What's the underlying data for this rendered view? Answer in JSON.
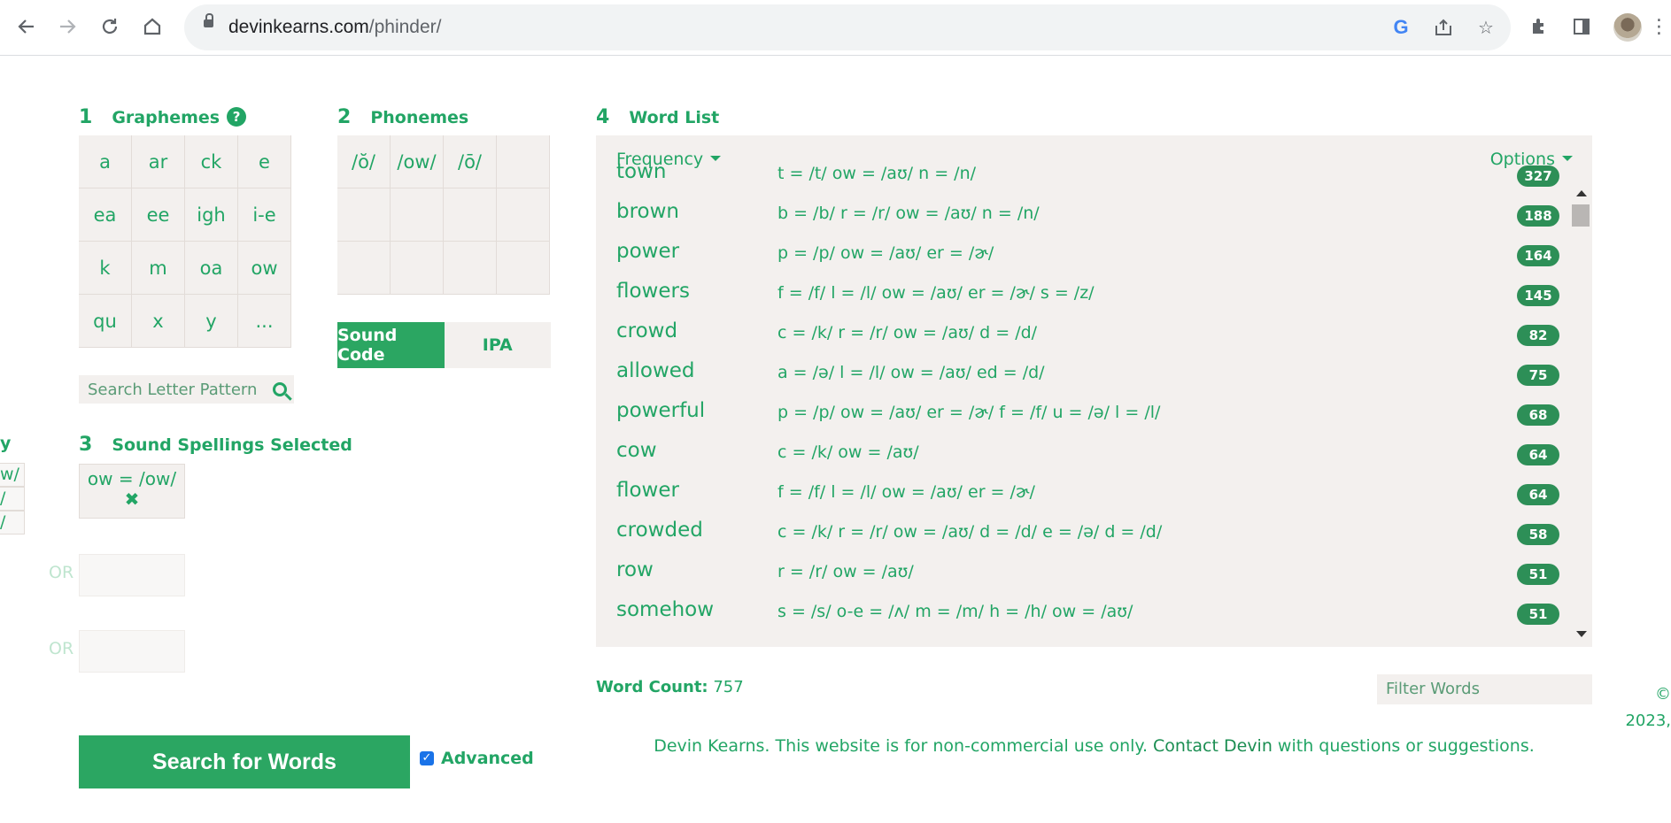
{
  "browser": {
    "url_domain": "devinkearns.com",
    "url_path": "/phinder/"
  },
  "graphemes": {
    "number": "1",
    "title": "Graphemes",
    "help": "?",
    "cells": [
      "a",
      "ar",
      "ck",
      "e",
      "ea",
      "ee",
      "igh",
      "i-e",
      "k",
      "m",
      "oa",
      "ow",
      "qu",
      "x",
      "y",
      "..."
    ]
  },
  "phonemes": {
    "number": "2",
    "title": "Phonemes",
    "cells": [
      "/ŏ/",
      "/ow/",
      "/ō/",
      "",
      "",
      "",
      "",
      "",
      "",
      "",
      "",
      ""
    ],
    "toggle_sound_code": "Sound Code",
    "toggle_ipa": "IPA"
  },
  "letter_search": {
    "placeholder": "Search Letter Pattern"
  },
  "sound_spellings": {
    "number": "3",
    "title": "Sound Spellings Selected",
    "selected": "ow = /ow/",
    "remove": "✖",
    "or_label_1": "OR",
    "or_label_2": "OR",
    "clipped_fragments": [
      "w/",
      "/",
      "/"
    ],
    "clipped_heading": "y"
  },
  "actions": {
    "search_button": "Search for Words",
    "advanced_label": "Advanced",
    "advanced_checked": "✓"
  },
  "word_list": {
    "number": "4",
    "title": "Word List",
    "sort_label": "Frequency",
    "options_label": "Options",
    "rows": [
      {
        "word": "town",
        "breakdown": "t = /t/ ow = /aʊ/ n = /n/",
        "count": "327"
      },
      {
        "word": "brown",
        "breakdown": "b = /b/ r = /r/ ow = /aʊ/ n = /n/",
        "count": "188"
      },
      {
        "word": "power",
        "breakdown": "p = /p/ ow = /aʊ/ er = /ɚ/",
        "count": "164"
      },
      {
        "word": "flowers",
        "breakdown": "f = /f/ l = /l/ ow = /aʊ/ er = /ɚ/ s = /z/",
        "count": "145"
      },
      {
        "word": "crowd",
        "breakdown": "c = /k/ r = /r/ ow = /aʊ/ d = /d/",
        "count": "82"
      },
      {
        "word": "allowed",
        "breakdown": "a = /ə/ l = /l/ ow = /aʊ/ ed = /d/",
        "count": "75"
      },
      {
        "word": "powerful",
        "breakdown": "p = /p/ ow = /aʊ/ er = /ɚ/ f = /f/ u = /ə/ l = /l/",
        "count": "68"
      },
      {
        "word": "cow",
        "breakdown": "c = /k/ ow = /aʊ/",
        "count": "64"
      },
      {
        "word": "flower",
        "breakdown": "f = /f/ l = /l/ ow = /aʊ/ er = /ɚ/",
        "count": "64"
      },
      {
        "word": "crowded",
        "breakdown": "c = /k/ r = /r/ ow = /aʊ/ d = /d/ e = /ə/ d = /d/",
        "count": "58"
      },
      {
        "word": "row",
        "breakdown": "r = /r/ ow = /aʊ/",
        "count": "51"
      },
      {
        "word": "somehow",
        "breakdown": "s = /s/ o-e = /ʌ/ m = /m/ h = /h/ ow = /aʊ/",
        "count": "51"
      }
    ],
    "word_count_label": "Word Count:",
    "word_count": "757",
    "filter_placeholder": "Filter Words"
  },
  "footer": {
    "copyright_symbol": "©",
    "copyright_year": "2023,",
    "text": "Devin Kearns. This website is for non-commercial use only. ",
    "contact": "Contact Devin",
    "text_end": " with questions or suggestions."
  },
  "colors": {
    "accent": "#22a565",
    "button": "#2ba662",
    "badge": "#2d8f57",
    "panel": "#f3f0ee"
  }
}
